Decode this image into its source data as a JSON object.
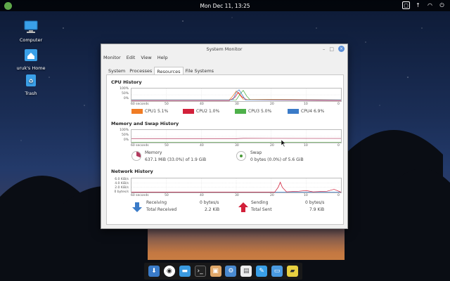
{
  "top_panel": {
    "clock": "Mon Dec 11, 13:25"
  },
  "desktop": {
    "icons": [
      {
        "label": "Computer"
      },
      {
        "label": "uruk's Home"
      },
      {
        "label": "Trash"
      }
    ]
  },
  "window": {
    "title": "System Monitor",
    "menu": [
      "Monitor",
      "Edit",
      "View",
      "Help"
    ],
    "tabs": [
      "System",
      "Processes",
      "Resources",
      "File Systems"
    ],
    "active_tab": "Resources",
    "x_axis": [
      "60 seconds",
      "50",
      "40",
      "30",
      "20",
      "10",
      "0"
    ],
    "cpu": {
      "title": "CPU History",
      "y_ticks": [
        "100%",
        "50%",
        "0%"
      ],
      "legend": [
        {
          "label": "CPU1",
          "value": "5.1%",
          "color": "#f07c24"
        },
        {
          "label": "CPU2",
          "value": "1.0%",
          "color": "#d2203a"
        },
        {
          "label": "CPU3",
          "value": "5.0%",
          "color": "#4eb04a"
        },
        {
          "label": "CPU4",
          "value": "6.9%",
          "color": "#3a7bc8"
        }
      ]
    },
    "memory": {
      "title": "Memory and Swap History",
      "y_ticks": [
        "100%",
        "50%",
        "0%"
      ],
      "memory_label": "Memory",
      "memory_value": "637.1 MiB (33.0%) of 1.9 GiB",
      "swap_label": "Swap",
      "swap_value": "0 bytes (0.0%) of 5.6 GiB",
      "memory_color": "#b23a5e",
      "swap_color": "#4a9a3a"
    },
    "network": {
      "title": "Network History",
      "y_ticks": [
        "6.0 KiB/s",
        "4.0 KiB/s",
        "2.0 KiB/s",
        "0 bytes/s"
      ],
      "receiving_label": "Receiving",
      "receiving_rate": "0 bytes/s",
      "total_received_label": "Total Received",
      "total_received": "2.2 KiB",
      "sending_label": "Sending",
      "sending_rate": "0 bytes/s",
      "total_sent_label": "Total Sent",
      "total_sent": "7.9 KiB",
      "receive_color": "#3a7bc8",
      "send_color": "#d2203a"
    }
  }
}
